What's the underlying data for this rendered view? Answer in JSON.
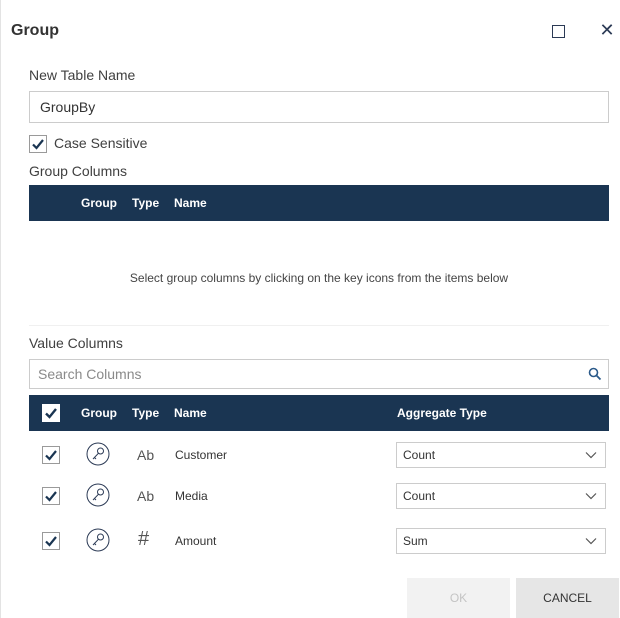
{
  "dialog": {
    "title": "Group",
    "maximize_icon": "maximize-icon",
    "close_icon": "close-icon"
  },
  "new_table": {
    "label": "New Table Name",
    "value": "GroupBy"
  },
  "case_sensitive": {
    "label": "Case Sensitive",
    "checked": true
  },
  "group_columns": {
    "label": "Group Columns",
    "headers": {
      "group": "Group",
      "type": "Type",
      "name": "Name"
    },
    "empty_message": "Select group columns by clicking on the key icons from the items below"
  },
  "value_columns": {
    "label": "Value Columns",
    "search_placeholder": "Search Columns",
    "search_icon": "search-icon",
    "headers": {
      "group": "Group",
      "type": "Type",
      "name": "Name",
      "aggregate": "Aggregate Type"
    },
    "rows": [
      {
        "checked": true,
        "icon": "key-icon",
        "type": "Ab",
        "name": "Customer",
        "aggregate": "Count"
      },
      {
        "checked": true,
        "icon": "key-icon",
        "type": "Ab",
        "name": "Media",
        "aggregate": "Count"
      },
      {
        "checked": true,
        "icon": "key-icon",
        "type": "#",
        "name": "Amount",
        "aggregate": "Sum"
      }
    ]
  },
  "footer": {
    "ok_label": "OK",
    "cancel_label": "CANCEL"
  },
  "colors": {
    "header_bg": "#1a3552",
    "accent": "#2b3a55"
  }
}
